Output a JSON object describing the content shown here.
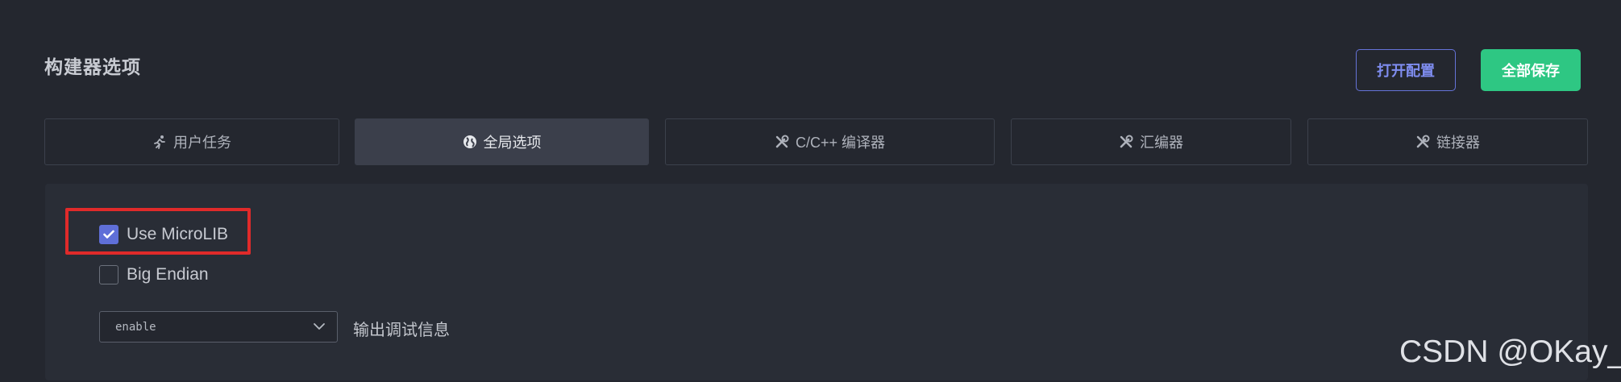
{
  "header": {
    "title": "构建器选项",
    "open_config_label": "打开配置",
    "save_all_label": "全部保存"
  },
  "tabs": [
    {
      "label": "用户任务",
      "icon": "run-icon",
      "active": false
    },
    {
      "label": "全局选项",
      "icon": "globe-icon",
      "active": true
    },
    {
      "label": "C/C++ 编译器",
      "icon": "tools-icon",
      "active": false
    },
    {
      "label": "汇编器",
      "icon": "tools-icon",
      "active": false
    },
    {
      "label": "链接器",
      "icon": "tools-icon",
      "active": false
    }
  ],
  "options": {
    "use_microlib": {
      "label": "Use MicroLIB",
      "checked": true
    },
    "big_endian": {
      "label": "Big Endian",
      "checked": false
    },
    "debug_info": {
      "value": "enable",
      "label": "输出调试信息"
    }
  },
  "watermark": "CSDN @OKay_J",
  "colors": {
    "background": "#24272f",
    "panel": "#292d36",
    "accent": "#5f6fd8",
    "save_green": "#2ec783",
    "highlight_red": "#e02a2a"
  }
}
